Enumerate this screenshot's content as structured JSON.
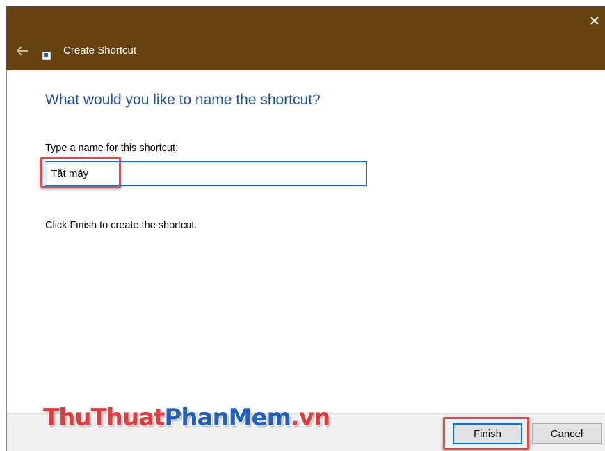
{
  "window": {
    "title": "Create Shortcut",
    "close_glyph": "✕"
  },
  "main": {
    "heading": "What would you like to name the shortcut?",
    "field_label": "Type a name for this shortcut:",
    "name_value": "Tắt máy",
    "info_text": "Click Finish to create the shortcut."
  },
  "buttons": {
    "finish_label": "Finish",
    "cancel_label": "Cancel"
  },
  "watermark": {
    "part1": "ThuThuat",
    "part2": "PhanMem",
    "part3": ".vn"
  },
  "colors": {
    "titlebar": "#654210",
    "accent": "#0078d7",
    "heading": "#1f4fa6",
    "highlight": "#e8474a"
  },
  "icons": {
    "back": "back-arrow-icon",
    "app": "shortcut-icon",
    "close": "close-icon"
  }
}
